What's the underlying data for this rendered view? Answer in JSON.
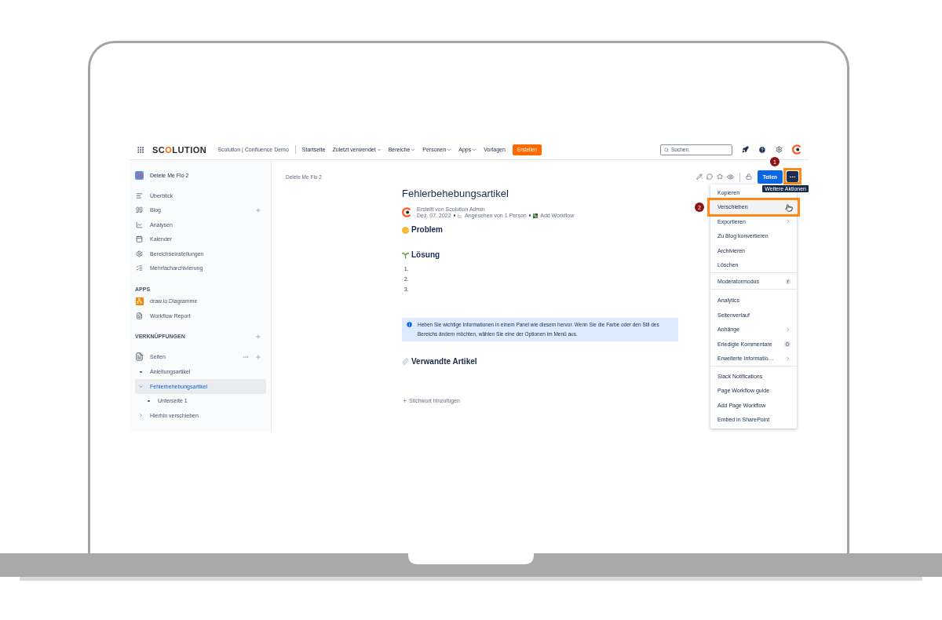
{
  "topnav": {
    "logo": "SCOLUTION",
    "site_name": "Scolution | Confluence Demo",
    "items": [
      {
        "label": "Startseite",
        "dropdown": false
      },
      {
        "label": "Zuletzt verwendet",
        "dropdown": true
      },
      {
        "label": "Bereiche",
        "dropdown": true
      },
      {
        "label": "Personen",
        "dropdown": true
      },
      {
        "label": "Apps",
        "dropdown": true
      },
      {
        "label": "Vorlagen",
        "dropdown": false
      }
    ],
    "create_button": "Erstellen",
    "search": {
      "placeholder": "Suchen"
    }
  },
  "sidebar": {
    "space_title": "Delete Me Flo 2",
    "items": [
      {
        "label": "Überblick"
      },
      {
        "label": "Blog"
      },
      {
        "label": "Analysen"
      },
      {
        "label": "Kalender"
      },
      {
        "label": "Bereichseinstellungen"
      },
      {
        "label": "Mehrfacharchivierung"
      }
    ],
    "apps_heading": "APPS",
    "apps": [
      {
        "label": "draw.io Diagramme"
      },
      {
        "label": "Workflow Report"
      }
    ],
    "links_heading": "VERKNÜPFUNGEN",
    "pages": {
      "label": "Seiten",
      "children": [
        {
          "label": "Anleitungsartikel",
          "kind": "page",
          "selected": false
        },
        {
          "label": "Fehlerbehebungsartikel",
          "kind": "group",
          "selected": true,
          "expanded": true,
          "children": [
            {
              "label": "Unterseite 1",
              "kind": "page",
              "selected": false
            }
          ]
        },
        {
          "label": "Hierhin verschieben",
          "kind": "group",
          "selected": false,
          "expanded": false
        }
      ]
    }
  },
  "page": {
    "breadcrumb": "Delete Me Flo 2",
    "share_button": "Teilen",
    "more_tooltip": "Weitere Aktionen",
    "title": "Fehlerbehebungsartikel",
    "author": "Erstellt von Scolution Admin",
    "date": "Dez. 07, 2022",
    "views": "Angesehen von 1 Person",
    "workflow": "Add Workflow",
    "problem_heading": "Problem",
    "solution_heading": "Lösung",
    "list_numbers": [
      "1.",
      "2.",
      "3."
    ],
    "info_panel": "Heben Sie wichtige Informationen in einem Panel wie diesem hervor. Wenn Sie die Farbe oder den Stil des Bereichs ändern möchten, wählen Sie eine der Optionen im Menü aus.",
    "related_heading": "Verwandte Artikel",
    "add_label": "Stichwort hinzufügen"
  },
  "menu": {
    "sections": [
      {
        "items": [
          {
            "label": "Kopieren",
            "submenu": false,
            "selected": false
          },
          {
            "label": "Verschieben",
            "submenu": false,
            "selected": true
          },
          {
            "label": "Exportieren",
            "submenu": true,
            "selected": false
          },
          {
            "label": "Zu Blog konvertieren",
            "submenu": false,
            "selected": false
          },
          {
            "label": "Archivieren",
            "submenu": false,
            "selected": false
          },
          {
            "label": "Löschen",
            "submenu": false,
            "selected": false
          }
        ]
      },
      {
        "items": [
          {
            "label": "Moderatormodus",
            "submenu": false,
            "selected": false,
            "badge": "r"
          }
        ]
      },
      {
        "items": [
          {
            "label": "Analytics",
            "submenu": false,
            "selected": false
          },
          {
            "label": "Seitenverlauf",
            "submenu": false,
            "selected": false
          },
          {
            "label": "Anhänge",
            "submenu": true,
            "selected": false
          },
          {
            "label": "Erledigte Kommentare",
            "submenu": false,
            "selected": false,
            "badge": "0"
          },
          {
            "label": "Erweiterte Informatio…",
            "submenu": true,
            "selected": false
          }
        ]
      },
      {
        "items": [
          {
            "label": "Slack Notifications",
            "submenu": false,
            "selected": false
          },
          {
            "label": "Page Workflow guide",
            "submenu": false,
            "selected": false
          },
          {
            "label": "Add Page Workflow",
            "submenu": false,
            "selected": false
          },
          {
            "label": "Embed in SharePoint",
            "submenu": false,
            "selected": false
          }
        ]
      }
    ]
  },
  "callouts": [
    "1",
    "2"
  ]
}
